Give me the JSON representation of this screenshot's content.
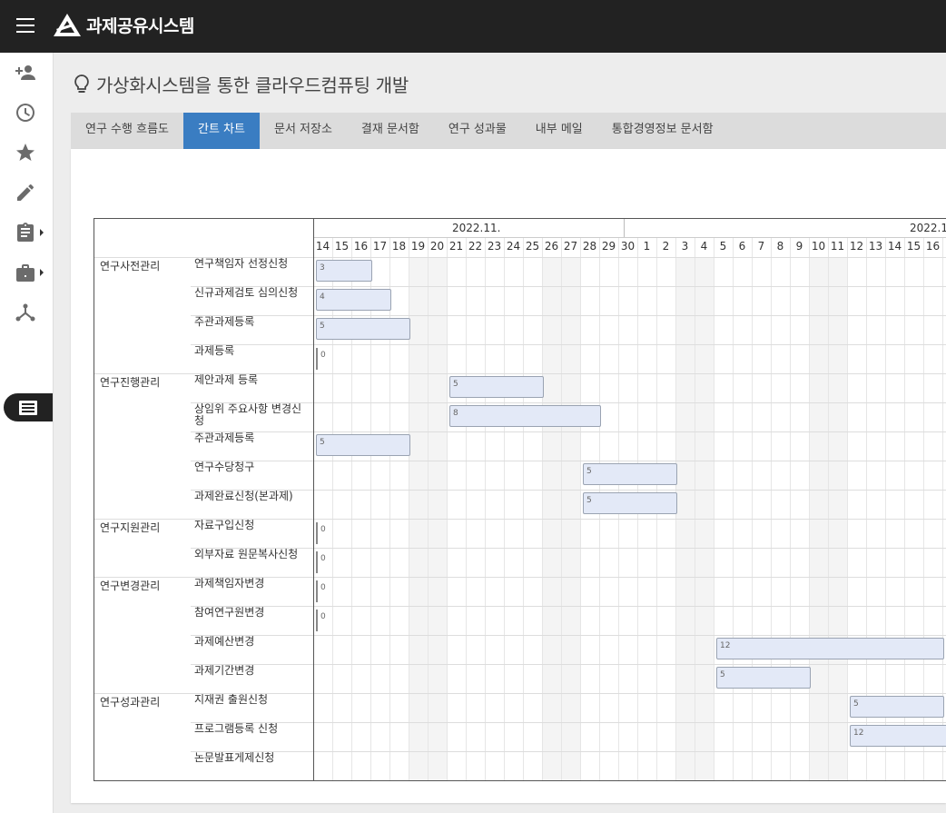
{
  "header": {
    "app_title": "과제공유시스템"
  },
  "sidebar": {
    "icons": [
      "add-user-icon",
      "clock-icon",
      "star-icon",
      "pencil-icon",
      "clipboard-icon",
      "briefcase-icon",
      "hierarchy-icon",
      "list-icon"
    ]
  },
  "page": {
    "title": "가상화시스템을 통한 클라우드컴퓨팅 개발"
  },
  "tabs": [
    "연구 수행 흐름도",
    "간트 차트",
    "문서 저장소",
    "결재 문서함",
    "연구 성과물",
    "내부 메일",
    "통합경영정보 문서함"
  ],
  "active_tab": "간트 차트",
  "gantt": {
    "months": [
      "2022.11.",
      "2022.1"
    ],
    "days": [
      "14",
      "15",
      "16",
      "17",
      "18",
      "19",
      "20",
      "21",
      "22",
      "23",
      "24",
      "25",
      "26",
      "27",
      "28",
      "29",
      "30",
      "1",
      "2",
      "3",
      "4",
      "5",
      "6",
      "7",
      "8",
      "9",
      "10",
      "11",
      "12",
      "13",
      "14",
      "15",
      "16"
    ],
    "groups": [
      {
        "name": "연구사전관리",
        "tasks": [
          {
            "name": "연구책임자 선정신청",
            "value": "3"
          },
          {
            "name": "신규과제검토 심의신청",
            "value": "4"
          },
          {
            "name": "주관과제등록",
            "value": "5"
          },
          {
            "name": "과제등록",
            "value": "0"
          }
        ]
      },
      {
        "name": "연구진행관리",
        "tasks": [
          {
            "name": "제안과제 등록",
            "value": "5"
          },
          {
            "name": "상임위 주요사항 변경신청",
            "value": "8"
          },
          {
            "name": "주관과제등록",
            "value": "5"
          },
          {
            "name": "연구수당청구",
            "value": "5"
          },
          {
            "name": "과제완료신청(본과제)",
            "value": "5"
          }
        ]
      },
      {
        "name": "연구지원관리",
        "tasks": [
          {
            "name": "자료구입신청",
            "value": "0"
          },
          {
            "name": "외부자료 원문복사신청",
            "value": "0"
          }
        ]
      },
      {
        "name": "연구변경관리",
        "tasks": [
          {
            "name": "과제책임자변경",
            "value": "0"
          },
          {
            "name": "참여연구원변경",
            "value": "0"
          },
          {
            "name": "과제예산변경",
            "value": "12"
          },
          {
            "name": "과제기간변경",
            "value": "5"
          }
        ]
      },
      {
        "name": "연구성과관리",
        "tasks": [
          {
            "name": "지재권 출원신청",
            "value": "5"
          },
          {
            "name": "프로그램등록 신청",
            "value": "12"
          },
          {
            "name": "논문발표게제신청",
            "value": ""
          }
        ]
      }
    ]
  }
}
